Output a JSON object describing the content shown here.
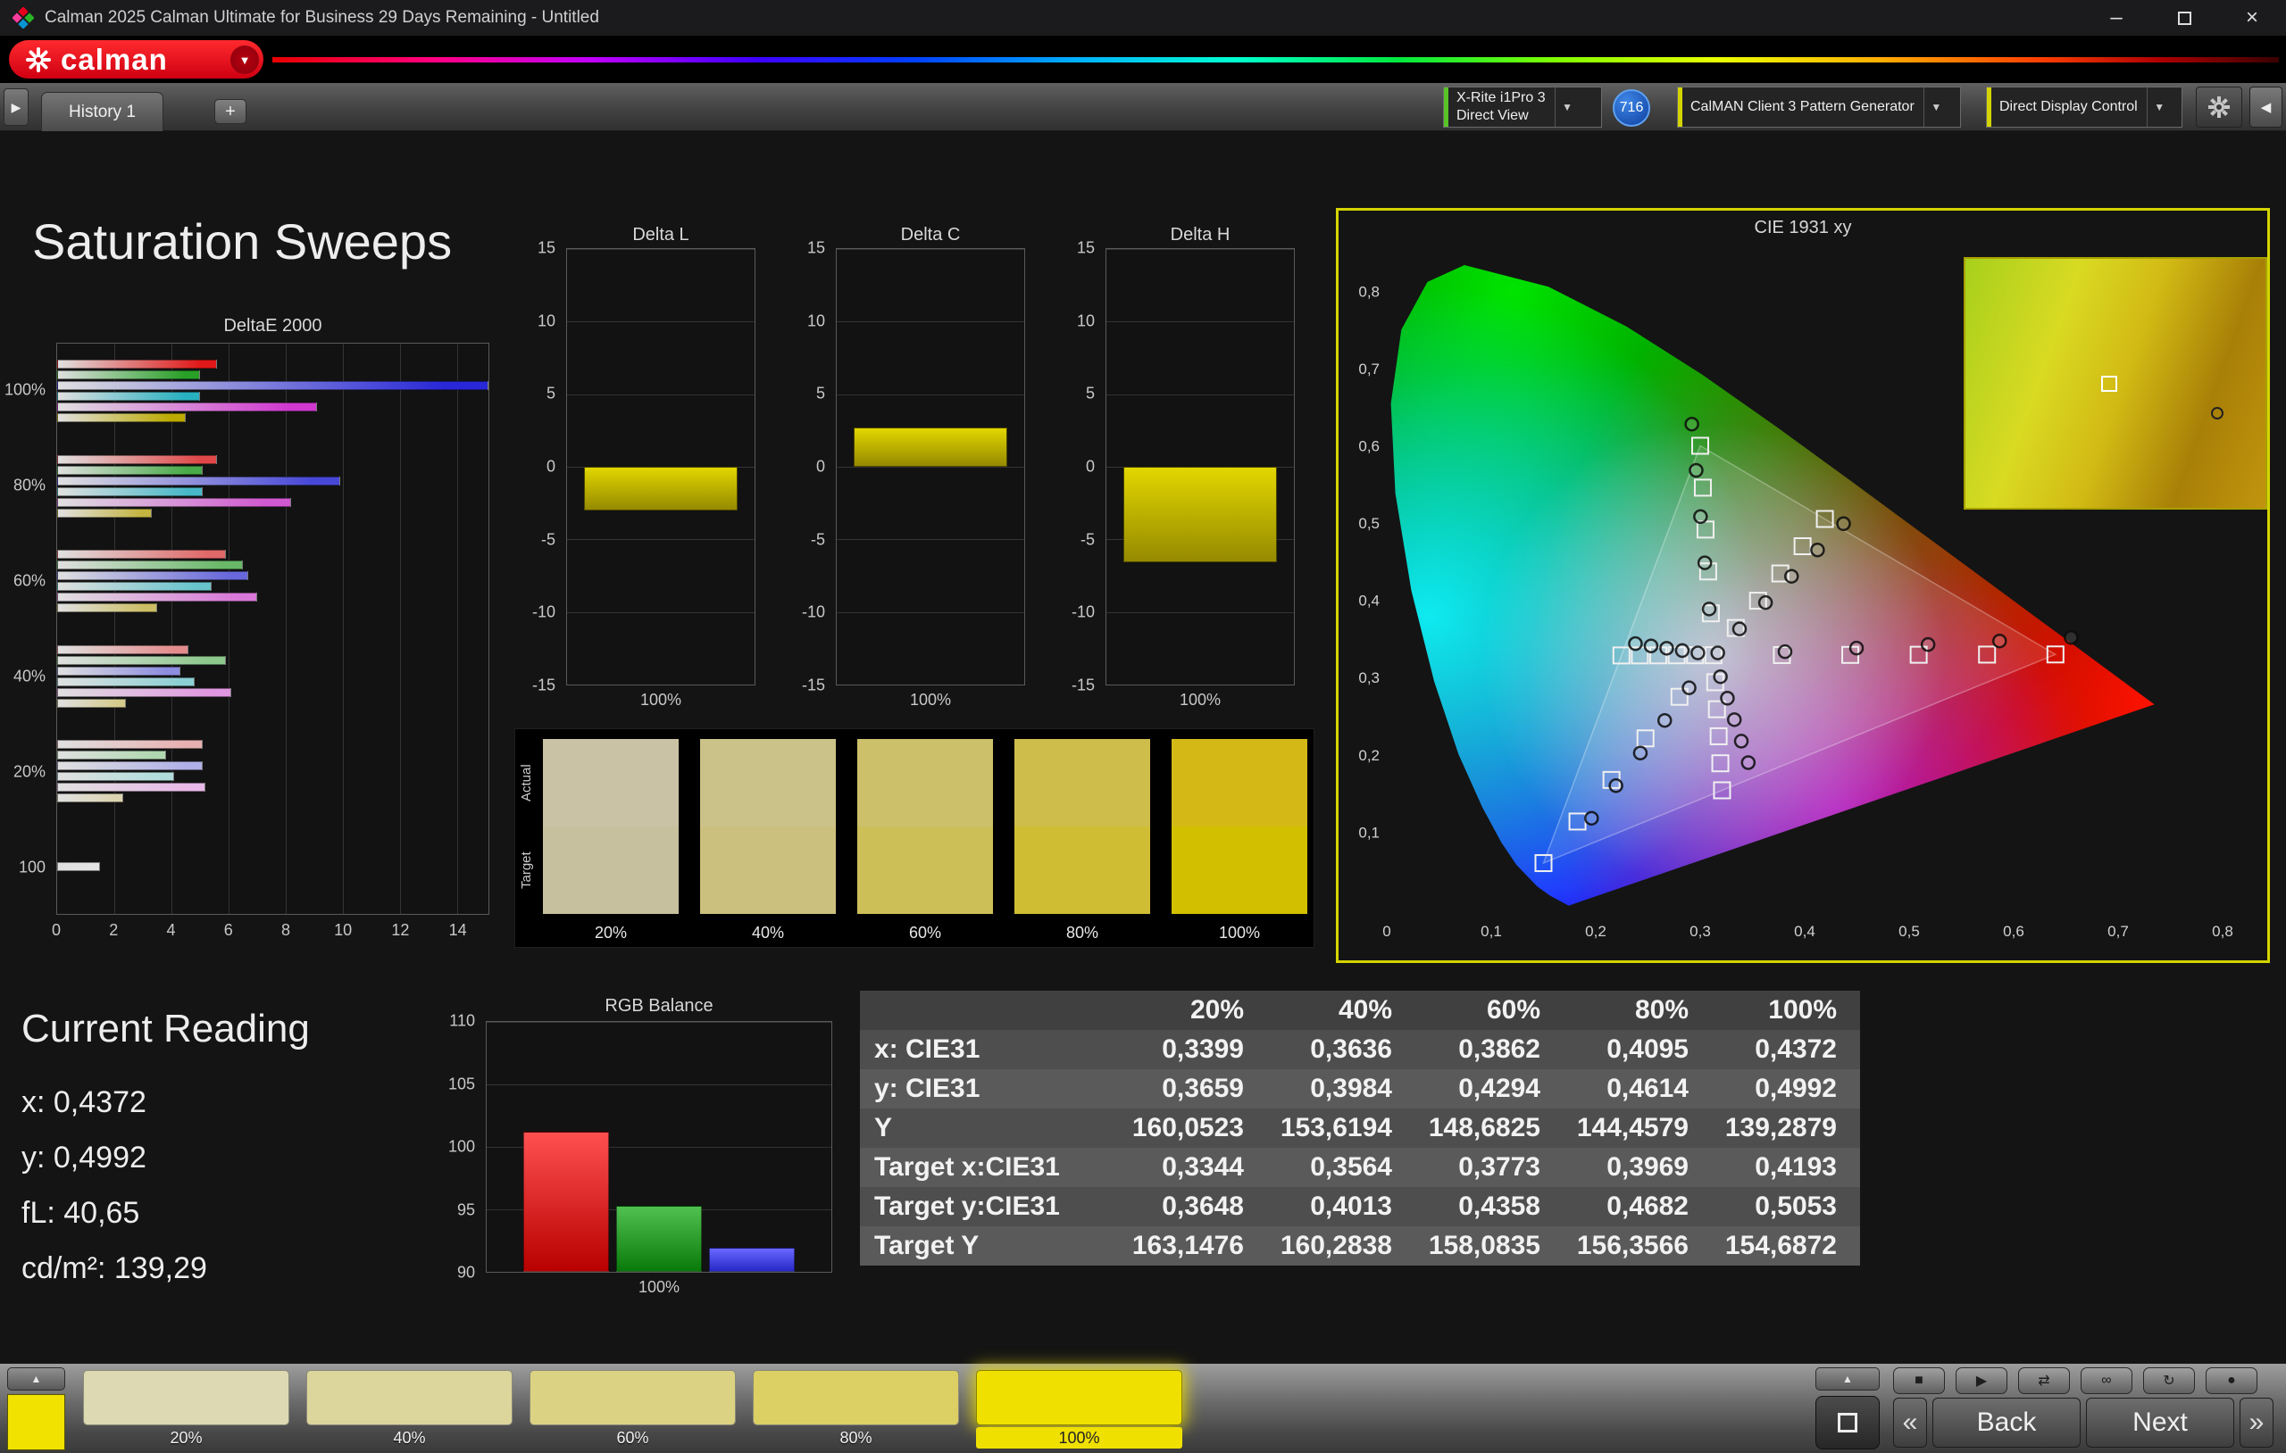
{
  "titlebar": {
    "title": "Calman 2025 Calman Ultimate for Business 29 Days Remaining  - Untitled",
    "minimize_glyph": "–",
    "close_glyph": "×"
  },
  "brandbar": {
    "logo_text": "calman",
    "dropdown_glyph": "▼"
  },
  "tabbar": {
    "expander_glyph": "▶",
    "history_tab": "History 1",
    "add_tab": "+",
    "meter_device": {
      "line1": "X-Rite i1Pro 3",
      "line2": "Direct View"
    },
    "meter_badge": "716",
    "pattern_generator": "CalMAN Client 3 Pattern Generator",
    "display_control": "Direct Display Control",
    "dropdown_glyph": "▼",
    "collapse_glyph": "◀"
  },
  "page": {
    "title": "Saturation Sweeps"
  },
  "current_reading": {
    "title": "Current Reading",
    "x": "x: 0,4372",
    "y": "y: 0,4992",
    "fl": "fL: 40,65",
    "cdm2": "cd/m²: 139,29"
  },
  "results_table": {
    "columns": [
      "20%",
      "40%",
      "60%",
      "80%",
      "100%"
    ],
    "rows": [
      {
        "label": "x: CIE31",
        "values": [
          "0,3399",
          "0,3636",
          "0,3862",
          "0,4095",
          "0,4372"
        ]
      },
      {
        "label": "y: CIE31",
        "values": [
          "0,3659",
          "0,3984",
          "0,4294",
          "0,4614",
          "0,4992"
        ]
      },
      {
        "label": "Y",
        "values": [
          "160,0523",
          "153,6194",
          "148,6825",
          "144,4579",
          "139,2879"
        ]
      },
      {
        "label": "Target x:CIE31",
        "values": [
          "0,3344",
          "0,3564",
          "0,3773",
          "0,3969",
          "0,4193"
        ]
      },
      {
        "label": "Target y:CIE31",
        "values": [
          "0,3648",
          "0,4013",
          "0,4358",
          "0,4682",
          "0,5053"
        ]
      },
      {
        "label": "Target Y",
        "values": [
          "163,1476",
          "160,2838",
          "158,0835",
          "156,3566",
          "154,6872"
        ]
      }
    ]
  },
  "swatch_compare": {
    "row_labels": [
      "Actual",
      "Target"
    ],
    "columns": [
      {
        "label": "20%",
        "actual": "#c9c2a4",
        "target": "#c7c09e"
      },
      {
        "label": "40%",
        "actual": "#cbc289",
        "target": "#cbc07e"
      },
      {
        "label": "60%",
        "actual": "#cdc06b",
        "target": "#ccbf58"
      },
      {
        "label": "80%",
        "actual": "#cfbd4b",
        "target": "#cfbe33"
      },
      {
        "label": "100%",
        "actual": "#d4b916",
        "target": "#d2bf00"
      }
    ]
  },
  "bottombar": {
    "patch_color": "#f2e200",
    "swatches": [
      {
        "label": "20%",
        "color": "#ddd9b2",
        "selected": false
      },
      {
        "label": "40%",
        "color": "#dcd59c",
        "selected": false
      },
      {
        "label": "60%",
        "color": "#dcd283",
        "selected": false
      },
      {
        "label": "80%",
        "color": "#dccf64",
        "selected": false
      },
      {
        "label": "100%",
        "color": "#f0e000",
        "selected": true
      }
    ],
    "transport": {
      "up_glyph": "▲",
      "buttons": [
        {
          "name": "stop",
          "glyph": "■"
        },
        {
          "name": "play",
          "glyph": "▶"
        },
        {
          "name": "step",
          "glyph": "⇄"
        },
        {
          "name": "continuous",
          "glyph": "∞"
        },
        {
          "name": "refresh",
          "glyph": "↻"
        },
        {
          "name": "record",
          "glyph": "●"
        }
      ],
      "prev_glyph": "«",
      "back_label": "Back",
      "next_label": "Next",
      "next_glyph": "»"
    }
  },
  "chart_data": [
    {
      "id": "deltae2000",
      "type": "bar",
      "orientation": "horizontal",
      "title": "DeltaE 2000",
      "xlim": [
        0,
        15.1
      ],
      "xticks": [
        0,
        2,
        4,
        6,
        8,
        10,
        12,
        14
      ],
      "groups": [
        {
          "label": "100%",
          "bars": [
            {
              "name": "red",
              "value": 5.6,
              "color": "#e01818"
            },
            {
              "name": "green",
              "value": 5.0,
              "color": "#28a028"
            },
            {
              "name": "blue",
              "value": 15.1,
              "color": "#2828d8"
            },
            {
              "name": "cyan",
              "value": 5.0,
              "color": "#28b0c0"
            },
            {
              "name": "magenta",
              "value": 9.1,
              "color": "#d038d0"
            },
            {
              "name": "yellow",
              "value": 4.5,
              "color": "#bcaa00"
            }
          ]
        },
        {
          "label": "80%",
          "bars": [
            {
              "name": "red",
              "value": 5.6,
              "color": "#e04848"
            },
            {
              "name": "green",
              "value": 5.1,
              "color": "#48aa48"
            },
            {
              "name": "blue",
              "value": 9.9,
              "color": "#4848d8"
            },
            {
              "name": "cyan",
              "value": 5.1,
              "color": "#48b8c8"
            },
            {
              "name": "magenta",
              "value": 8.2,
              "color": "#d058d0"
            },
            {
              "name": "yellow",
              "value": 3.3,
              "color": "#c4b440"
            }
          ]
        },
        {
          "label": "60%",
          "bars": [
            {
              "name": "red",
              "value": 5.9,
              "color": "#e06868"
            },
            {
              "name": "green",
              "value": 6.5,
              "color": "#68b868"
            },
            {
              "name": "blue",
              "value": 6.7,
              "color": "#6868dc"
            },
            {
              "name": "cyan",
              "value": 5.4,
              "color": "#68c4cc"
            },
            {
              "name": "magenta",
              "value": 7.0,
              "color": "#d878d8"
            },
            {
              "name": "yellow",
              "value": 3.5,
              "color": "#ccbe64"
            }
          ]
        },
        {
          "label": "40%",
          "bars": [
            {
              "name": "red",
              "value": 4.6,
              "color": "#e48c8c"
            },
            {
              "name": "green",
              "value": 5.9,
              "color": "#8cc88c"
            },
            {
              "name": "blue",
              "value": 4.3,
              "color": "#8c8ce0"
            },
            {
              "name": "cyan",
              "value": 4.8,
              "color": "#8cd0d4"
            },
            {
              "name": "magenta",
              "value": 6.1,
              "color": "#e096e0"
            },
            {
              "name": "yellow",
              "value": 2.4,
              "color": "#d4ca8c"
            }
          ]
        },
        {
          "label": "20%",
          "bars": [
            {
              "name": "red",
              "value": 5.1,
              "color": "#e8b0b0"
            },
            {
              "name": "green",
              "value": 3.8,
              "color": "#b0d8b0"
            },
            {
              "name": "blue",
              "value": 5.1,
              "color": "#b0b0e8"
            },
            {
              "name": "cyan",
              "value": 4.1,
              "color": "#b0dcdc"
            },
            {
              "name": "magenta",
              "value": 5.2,
              "color": "#e8b8e8"
            },
            {
              "name": "yellow",
              "value": 2.3,
              "color": "#dcd4b0"
            }
          ]
        },
        {
          "label": "100",
          "bars": [
            {
              "name": "white",
              "value": 1.5,
              "color": "#e4e4e4"
            }
          ]
        }
      ]
    },
    {
      "id": "deltaL",
      "type": "bar",
      "title": "Delta L",
      "ylim": [
        -15,
        15
      ],
      "yticks": [
        15,
        10,
        5,
        0,
        -5,
        -10,
        -15
      ],
      "categories": [
        "100%"
      ],
      "values": [
        -3.0
      ]
    },
    {
      "id": "deltaC",
      "type": "bar",
      "title": "Delta C",
      "ylim": [
        -15,
        15
      ],
      "yticks": [
        15,
        10,
        5,
        0,
        -5,
        -10,
        -15
      ],
      "categories": [
        "100%"
      ],
      "values": [
        2.7
      ]
    },
    {
      "id": "deltaH",
      "type": "bar",
      "title": "Delta H",
      "ylim": [
        -15,
        15
      ],
      "yticks": [
        15,
        10,
        5,
        0,
        -5,
        -10,
        -15
      ],
      "categories": [
        "100%"
      ],
      "values": [
        -6.6
      ]
    },
    {
      "id": "rgb_balance",
      "type": "bar",
      "title": "RGB Balance",
      "ylim": [
        90,
        110
      ],
      "yticks": [
        110,
        105,
        100,
        95,
        90
      ],
      "categories": [
        "100%"
      ],
      "series": [
        {
          "name": "Red",
          "value": 101.2,
          "color": "#ff5050",
          "color2": "#b80000"
        },
        {
          "name": "Green",
          "value": 95.3,
          "color": "#50c050",
          "color2": "#0a7a0a"
        },
        {
          "name": "Blue",
          "value": 91.9,
          "color": "#6868ff",
          "color2": "#2828c8"
        }
      ]
    },
    {
      "id": "cie1931",
      "type": "scatter",
      "title": "CIE 1931 xy",
      "xlim": [
        0,
        0.8
      ],
      "ylim": [
        0,
        0.85
      ],
      "xticks": [
        "0",
        "0,1",
        "0,2",
        "0,3",
        "0,4",
        "0,5",
        "0,6",
        "0,7",
        "0,8"
      ],
      "yticks": [
        "0",
        "0,1",
        "0,2",
        "0,3",
        "0,4",
        "0,5",
        "0,6",
        "0,7",
        "0,8"
      ],
      "white_point": [
        0.3127,
        0.329
      ],
      "gamut_triangle": {
        "red": [
          0.64,
          0.33
        ],
        "green": [
          0.3,
          0.6
        ],
        "blue": [
          0.15,
          0.06
        ]
      },
      "saturation_levels": [
        0.2,
        0.4,
        0.6,
        0.8,
        1.0
      ],
      "sweep_targets": {
        "red": [
          0.64,
          0.33
        ],
        "green": [
          0.3,
          0.6
        ],
        "blue": [
          0.15,
          0.06
        ],
        "cyan": [
          0.2246,
          0.3287
        ],
        "magenta": [
          0.3209,
          0.1542
        ],
        "yellow": [
          0.4193,
          0.5053
        ]
      },
      "sweep_measured_end": {
        "red": [
          0.655,
          0.352
        ],
        "green": [
          0.292,
          0.628
        ],
        "blue": [
          0.196,
          0.118
        ],
        "cyan": [
          0.238,
          0.344
        ],
        "magenta": [
          0.346,
          0.19
        ],
        "yellow": [
          0.4372,
          0.4992
        ]
      },
      "inset": {
        "marker_square": [
          0.48,
          0.5
        ],
        "marker_circle": [
          0.84,
          0.62
        ]
      },
      "locus": [
        [
          0.1741,
          0.005
        ],
        [
          0.1566,
          0.0177
        ],
        [
          0.144,
          0.0297
        ],
        [
          0.1241,
          0.0578
        ],
        [
          0.1096,
          0.0868
        ],
        [
          0.0913,
          0.1327
        ],
        [
          0.0687,
          0.2007
        ],
        [
          0.0454,
          0.295
        ],
        [
          0.0235,
          0.4127
        ],
        [
          0.0082,
          0.5384
        ],
        [
          0.0039,
          0.6548
        ],
        [
          0.0139,
          0.7502
        ],
        [
          0.0389,
          0.812
        ],
        [
          0.0743,
          0.8338
        ],
        [
          0.1547,
          0.8059
        ],
        [
          0.2296,
          0.7543
        ],
        [
          0.3016,
          0.6923
        ],
        [
          0.3731,
          0.6245
        ],
        [
          0.4441,
          0.5547
        ],
        [
          0.5125,
          0.4866
        ],
        [
          0.5752,
          0.4242
        ],
        [
          0.627,
          0.3725
        ],
        [
          0.6658,
          0.334
        ],
        [
          0.6915,
          0.3083
        ],
        [
          0.726,
          0.274
        ],
        [
          0.7347,
          0.2653
        ]
      ]
    }
  ]
}
